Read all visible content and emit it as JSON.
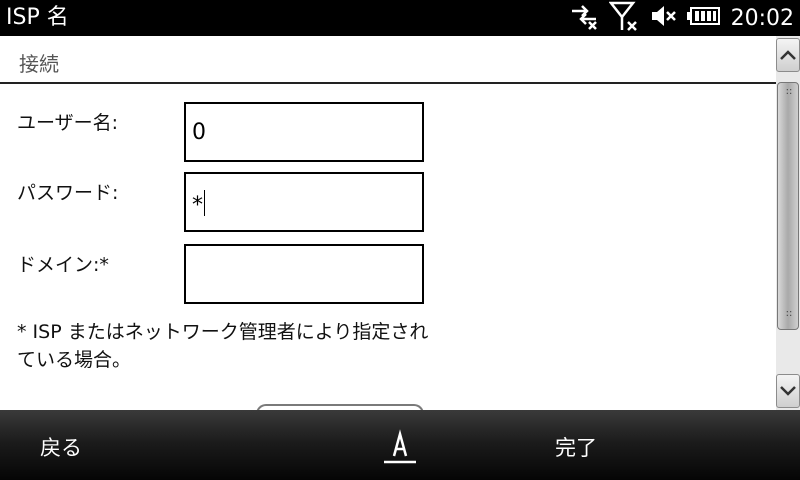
{
  "statusbar": {
    "title": "ISP 名",
    "time": "20:02",
    "icons": [
      "connectivity-icon",
      "signal-off-icon",
      "speaker-muted-icon",
      "battery-icon"
    ]
  },
  "section": {
    "title": "接続"
  },
  "form": {
    "username": {
      "label": "ユーザー名:",
      "value": "0"
    },
    "password": {
      "label": "パスワード:",
      "value": "*"
    },
    "domain": {
      "label": "ドメイン:*",
      "value": ""
    },
    "note": "* ISP またはネットワーク管理者により指定されている場合。"
  },
  "softkeys": {
    "left": "戻る",
    "right": "完了"
  },
  "colors": {
    "bar": "#000000",
    "background": "#ffffff",
    "border": "#000000"
  }
}
